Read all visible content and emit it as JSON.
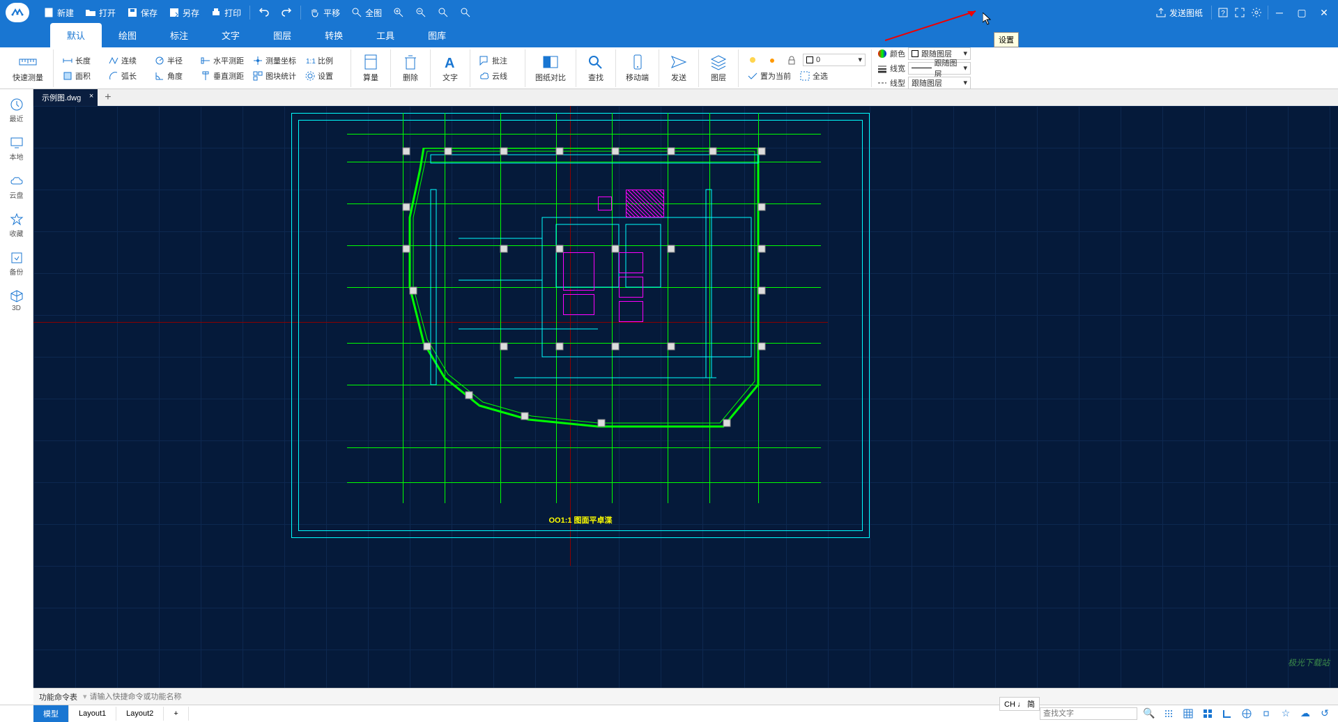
{
  "titlebar": {
    "new": "新建",
    "open": "打开",
    "save": "保存",
    "saveas": "另存",
    "print": "打印",
    "pan": "平移",
    "fit": "全图",
    "send": "发送图纸"
  },
  "tooltip_settings": "设置",
  "menu": {
    "tabs": [
      "默认",
      "绘图",
      "标注",
      "文字",
      "图层",
      "转换",
      "工具",
      "图库"
    ]
  },
  "ribbon": {
    "quick_measure": "快速测量",
    "length": "长度",
    "continuous": "连续",
    "radius": "半径",
    "hdist": "水平测距",
    "coord": "测量坐标",
    "scale": "比例",
    "area": "面积",
    "arc": "弧长",
    "angle": "角度",
    "vdist": "垂直测距",
    "blockcount": "图块统计",
    "settings": "设置",
    "calc": "算量",
    "del": "删除",
    "text": "文字",
    "annotate": "批注",
    "cloud": "云线",
    "compare": "图纸对比",
    "find": "查找",
    "mobile": "移动端",
    "send": "发送",
    "layer": "图层",
    "setcur": "置为当前",
    "selall": "全选",
    "color": "颜色",
    "bylayer": "跟随图层",
    "lw": "线宽",
    "lt": "线型",
    "layer_combo": "0"
  },
  "sidebar": {
    "items": [
      "最近",
      "本地",
      "云盘",
      "收藏",
      "备份",
      "3D"
    ]
  },
  "doctab": {
    "name": "示例图.dwg"
  },
  "drawing": {
    "title": "OO1:1   图面平卓渫"
  },
  "cmdbar": {
    "label": "功能命令表",
    "placeholder": "请输入快捷命令或功能名称"
  },
  "layouts": [
    "模型",
    "Layout1",
    "Layout2"
  ],
  "status": {
    "ime": "CH ♩ 简",
    "search_ph": "查找文字"
  },
  "watermark": "极光下载站"
}
